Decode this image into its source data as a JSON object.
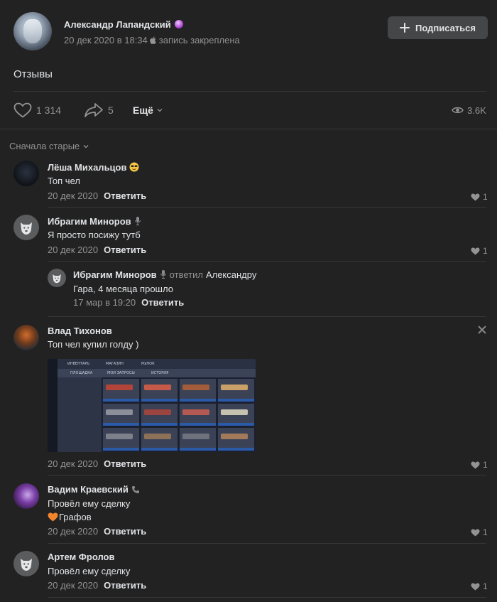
{
  "post": {
    "author": "Александр Лапандский",
    "date": "20 дек 2020 в 18:34",
    "pinned": "запись закреплена",
    "subscribe_label": "Подписаться",
    "text": "Отзывы",
    "likes": "1 314",
    "shares": "5",
    "more_label": "Ещё",
    "views": "3.6K"
  },
  "sort_label": "Сначала старые",
  "reply_label": "Ответить",
  "comments": [
    {
      "name": "Лёша Михальцов",
      "text": "Топ чел",
      "date": "20 дек 2020",
      "likes": "1"
    },
    {
      "name": "Ибрагим Миноров",
      "text": "Я просто посижу тутб",
      "date": "20 дек 2020",
      "likes": "1",
      "reply": {
        "name": "Ибрагим Миноров",
        "replied": "ответил",
        "to": "Александру",
        "text": "Гара, 4 месяца прошло",
        "date": "17 мар в 19:20"
      }
    },
    {
      "name": "Влад Тихонов",
      "text": "Топ чел купил голду )",
      "date": "20 дек 2020",
      "likes": "1",
      "screenshot": {
        "tabs": [
          "ИНВЕНТАРЬ",
          "МАГАЗИН",
          "РЫНОК"
        ],
        "subtabs": [
          "ПЛОЩАДКА",
          "МОИ ЗАПРОСЫ",
          "ИСТОРИЯ"
        ]
      }
    },
    {
      "name": "Вадим Краевский",
      "text_line1": "Провёл ему сделку",
      "text_line2": "Графов",
      "date": "20 дек 2020",
      "likes": "1"
    },
    {
      "name": "Артем Фролов",
      "text": "Провёл ему сделку",
      "date": "20 дек 2020",
      "likes": "1"
    }
  ],
  "colors": {
    "background": "#222222",
    "text": "#e1e3e6",
    "muted": "#939393",
    "button": "#454647",
    "divider": "#363738"
  }
}
